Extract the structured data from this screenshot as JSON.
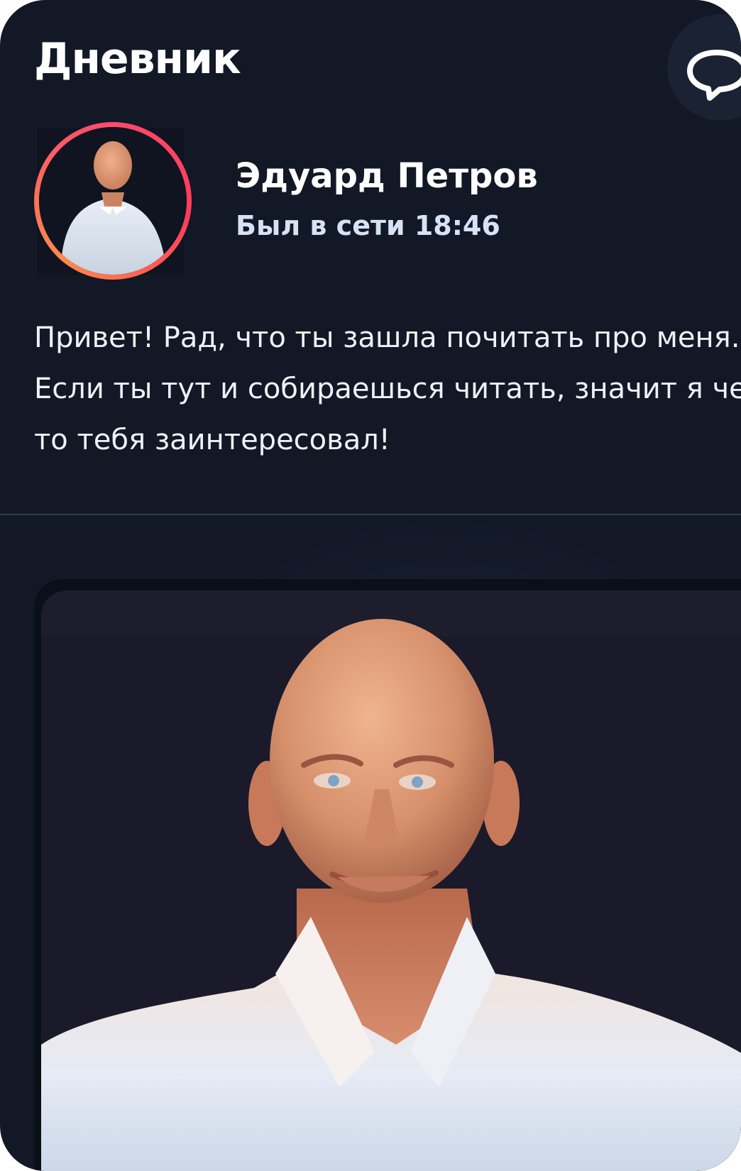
{
  "header": {
    "title": "Дневник",
    "chat_icon": "chat-bubble-icon"
  },
  "profile": {
    "name": "Эдуард Петров",
    "status": "Был в сети 18:46",
    "ring_colors": [
      "#ff8a4a",
      "#ff3b5c"
    ]
  },
  "intro": {
    "line1": "Привет! Рад, что ты зашла почитать про меня.",
    "line2": "Если ты тут и собираешься читать, значит я чем",
    "line3": "то тебя заинтересовал!"
  },
  "colors": {
    "background": "#121826",
    "divider": "#2c3a52",
    "status_text": "#d6e2f5"
  }
}
